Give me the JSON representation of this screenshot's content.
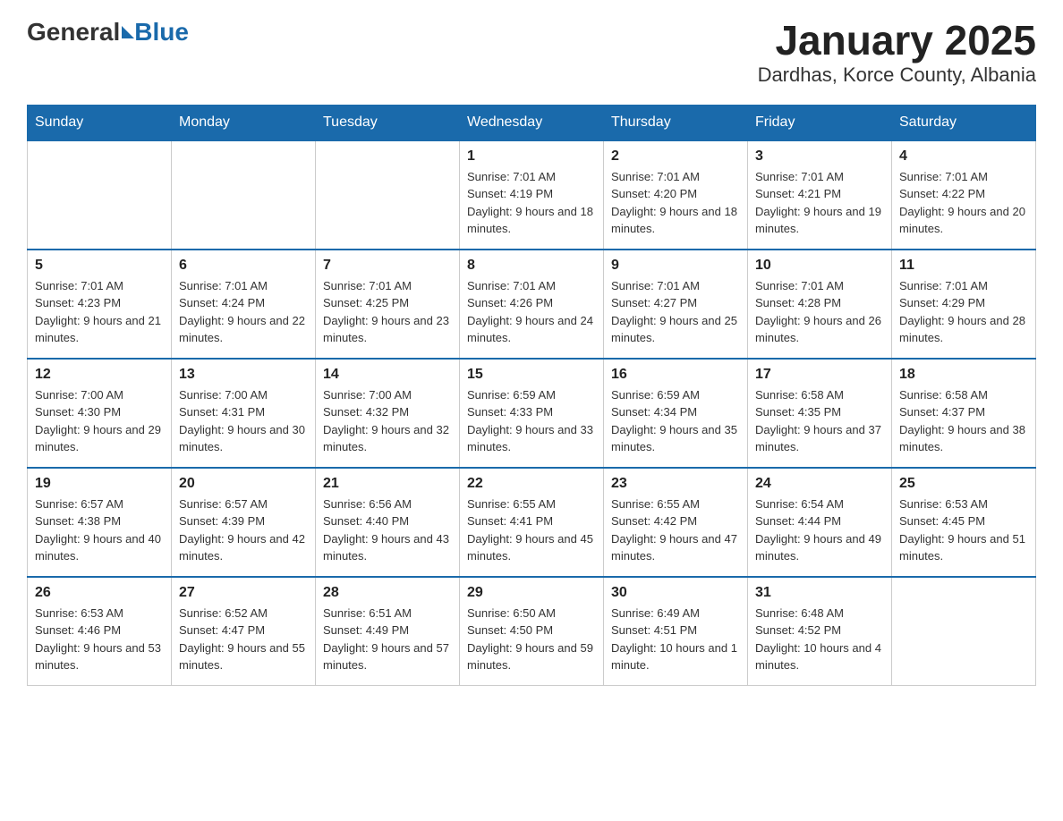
{
  "logo": {
    "general": "General",
    "blue": "Blue"
  },
  "title": "January 2025",
  "subtitle": "Dardhas, Korce County, Albania",
  "weekdays": [
    "Sunday",
    "Monday",
    "Tuesday",
    "Wednesday",
    "Thursday",
    "Friday",
    "Saturday"
  ],
  "weeks": [
    [
      {
        "day": "",
        "info": ""
      },
      {
        "day": "",
        "info": ""
      },
      {
        "day": "",
        "info": ""
      },
      {
        "day": "1",
        "info": "Sunrise: 7:01 AM\nSunset: 4:19 PM\nDaylight: 9 hours and 18 minutes."
      },
      {
        "day": "2",
        "info": "Sunrise: 7:01 AM\nSunset: 4:20 PM\nDaylight: 9 hours and 18 minutes."
      },
      {
        "day": "3",
        "info": "Sunrise: 7:01 AM\nSunset: 4:21 PM\nDaylight: 9 hours and 19 minutes."
      },
      {
        "day": "4",
        "info": "Sunrise: 7:01 AM\nSunset: 4:22 PM\nDaylight: 9 hours and 20 minutes."
      }
    ],
    [
      {
        "day": "5",
        "info": "Sunrise: 7:01 AM\nSunset: 4:23 PM\nDaylight: 9 hours and 21 minutes."
      },
      {
        "day": "6",
        "info": "Sunrise: 7:01 AM\nSunset: 4:24 PM\nDaylight: 9 hours and 22 minutes."
      },
      {
        "day": "7",
        "info": "Sunrise: 7:01 AM\nSunset: 4:25 PM\nDaylight: 9 hours and 23 minutes."
      },
      {
        "day": "8",
        "info": "Sunrise: 7:01 AM\nSunset: 4:26 PM\nDaylight: 9 hours and 24 minutes."
      },
      {
        "day": "9",
        "info": "Sunrise: 7:01 AM\nSunset: 4:27 PM\nDaylight: 9 hours and 25 minutes."
      },
      {
        "day": "10",
        "info": "Sunrise: 7:01 AM\nSunset: 4:28 PM\nDaylight: 9 hours and 26 minutes."
      },
      {
        "day": "11",
        "info": "Sunrise: 7:01 AM\nSunset: 4:29 PM\nDaylight: 9 hours and 28 minutes."
      }
    ],
    [
      {
        "day": "12",
        "info": "Sunrise: 7:00 AM\nSunset: 4:30 PM\nDaylight: 9 hours and 29 minutes."
      },
      {
        "day": "13",
        "info": "Sunrise: 7:00 AM\nSunset: 4:31 PM\nDaylight: 9 hours and 30 minutes."
      },
      {
        "day": "14",
        "info": "Sunrise: 7:00 AM\nSunset: 4:32 PM\nDaylight: 9 hours and 32 minutes."
      },
      {
        "day": "15",
        "info": "Sunrise: 6:59 AM\nSunset: 4:33 PM\nDaylight: 9 hours and 33 minutes."
      },
      {
        "day": "16",
        "info": "Sunrise: 6:59 AM\nSunset: 4:34 PM\nDaylight: 9 hours and 35 minutes."
      },
      {
        "day": "17",
        "info": "Sunrise: 6:58 AM\nSunset: 4:35 PM\nDaylight: 9 hours and 37 minutes."
      },
      {
        "day": "18",
        "info": "Sunrise: 6:58 AM\nSunset: 4:37 PM\nDaylight: 9 hours and 38 minutes."
      }
    ],
    [
      {
        "day": "19",
        "info": "Sunrise: 6:57 AM\nSunset: 4:38 PM\nDaylight: 9 hours and 40 minutes."
      },
      {
        "day": "20",
        "info": "Sunrise: 6:57 AM\nSunset: 4:39 PM\nDaylight: 9 hours and 42 minutes."
      },
      {
        "day": "21",
        "info": "Sunrise: 6:56 AM\nSunset: 4:40 PM\nDaylight: 9 hours and 43 minutes."
      },
      {
        "day": "22",
        "info": "Sunrise: 6:55 AM\nSunset: 4:41 PM\nDaylight: 9 hours and 45 minutes."
      },
      {
        "day": "23",
        "info": "Sunrise: 6:55 AM\nSunset: 4:42 PM\nDaylight: 9 hours and 47 minutes."
      },
      {
        "day": "24",
        "info": "Sunrise: 6:54 AM\nSunset: 4:44 PM\nDaylight: 9 hours and 49 minutes."
      },
      {
        "day": "25",
        "info": "Sunrise: 6:53 AM\nSunset: 4:45 PM\nDaylight: 9 hours and 51 minutes."
      }
    ],
    [
      {
        "day": "26",
        "info": "Sunrise: 6:53 AM\nSunset: 4:46 PM\nDaylight: 9 hours and 53 minutes."
      },
      {
        "day": "27",
        "info": "Sunrise: 6:52 AM\nSunset: 4:47 PM\nDaylight: 9 hours and 55 minutes."
      },
      {
        "day": "28",
        "info": "Sunrise: 6:51 AM\nSunset: 4:49 PM\nDaylight: 9 hours and 57 minutes."
      },
      {
        "day": "29",
        "info": "Sunrise: 6:50 AM\nSunset: 4:50 PM\nDaylight: 9 hours and 59 minutes."
      },
      {
        "day": "30",
        "info": "Sunrise: 6:49 AM\nSunset: 4:51 PM\nDaylight: 10 hours and 1 minute."
      },
      {
        "day": "31",
        "info": "Sunrise: 6:48 AM\nSunset: 4:52 PM\nDaylight: 10 hours and 4 minutes."
      },
      {
        "day": "",
        "info": ""
      }
    ]
  ]
}
